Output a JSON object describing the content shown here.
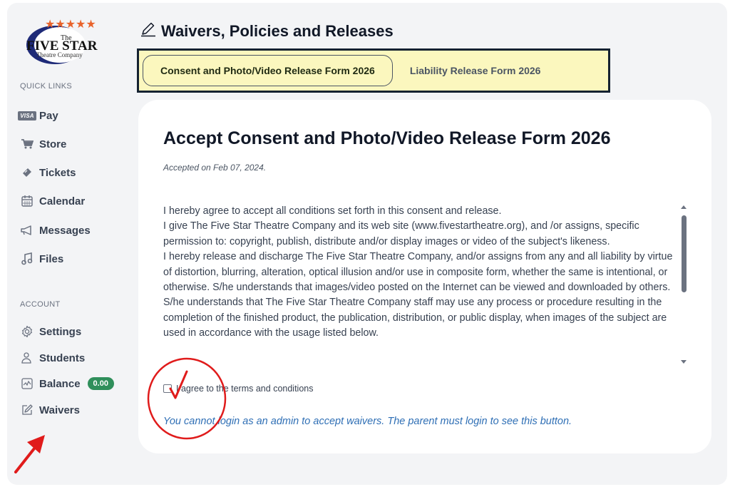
{
  "logo": {
    "stars": "★★★★★",
    "the": "The",
    "name": "FIVE STAR",
    "subtitle": "Theatre Company"
  },
  "sidebar": {
    "quick_links_heading": "QUICK LINKS",
    "quick_links": [
      {
        "label": "Pay",
        "icon": "visa-card-icon",
        "badge": "VISA"
      },
      {
        "label": "Store",
        "icon": "cart-icon"
      },
      {
        "label": "Tickets",
        "icon": "ticket-icon"
      },
      {
        "label": "Calendar",
        "icon": "calendar-icon"
      },
      {
        "label": "Messages",
        "icon": "megaphone-icon"
      },
      {
        "label": "Files",
        "icon": "music-note-icon"
      }
    ],
    "account_heading": "ACCOUNT",
    "account_links": [
      {
        "label": "Settings",
        "icon": "gear-icon"
      },
      {
        "label": "Students",
        "icon": "users-icon"
      },
      {
        "label": "Balance",
        "icon": "chart-icon",
        "badge": "0.00"
      },
      {
        "label": "Waivers",
        "icon": "edit-icon"
      }
    ]
  },
  "header": {
    "title": "Waivers, Policies and Releases",
    "tabs": [
      {
        "label": "Consent and Photo/Video Release Form 2026",
        "active": true
      },
      {
        "label": "Liability Release Form 2026",
        "active": false
      }
    ]
  },
  "card": {
    "title": "Accept Consent and Photo/Video Release Form 2026",
    "accepted": "Accepted on Feb 07, 2024.",
    "terms": [
      "I hereby agree to accept all conditions set forth in this consent and release.",
      "I give The Five Star Theatre Company and its web site (www.fivestartheatre.org), and /or assigns, specific permission to: copyright, publish, distribute and/or display images or video of the subject's likeness.",
      "I hereby release and discharge The Five Star Theatre Company, and/or assigns from any and all liability by virtue of distortion, blurring, alteration, optical illusion and/or use in composite form, whether the same is intentional, or otherwise. S/he understands that images/video posted on the Internet can be viewed and downloaded by others. S/he understands that The Five Star Theatre Company staff may use any process or procedure resulting in the completion of the finished product, the publication, distribution, or public display, when images of the subject are used in accordance with the usage listed below."
    ],
    "agree_label": "I agree to the terms and conditions",
    "admin_note": "You cannot login as an admin to accept waivers. The parent must login to see this button."
  },
  "colors": {
    "tab_bg": "#fbf7be",
    "tab_border": "#152231",
    "balance_badge": "#2f8f5b",
    "link_blue": "#2f6fb5",
    "annotation_red": "#e01b1b"
  }
}
